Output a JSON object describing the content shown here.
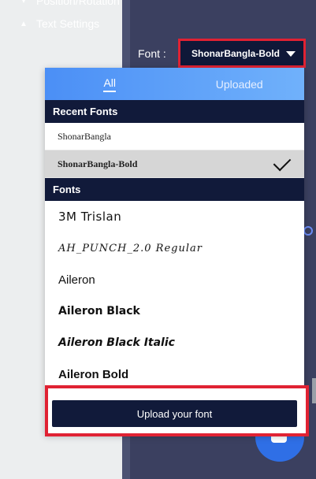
{
  "panel": {
    "position_rotation": "Position/Rotation",
    "text_settings": "Text Settings",
    "font_label": "Font :",
    "font_selected": "ShonarBangla-Bold"
  },
  "dropdown": {
    "tabs": [
      {
        "label": "All",
        "active": true
      },
      {
        "label": "Uploaded",
        "active": false
      }
    ],
    "recent_header": "Recent Fonts",
    "recent": [
      {
        "label": "ShonarBangla",
        "selected": false
      },
      {
        "label": "ShonarBangla-Bold",
        "selected": true
      }
    ],
    "fonts_header": "Fonts",
    "fonts": [
      {
        "label": "3M Trislan"
      },
      {
        "label": "AH_PUNCH_2.0 Regular"
      },
      {
        "label": "Aileron"
      },
      {
        "label": "Aileron Black"
      },
      {
        "label": "Aileron Black Italic"
      },
      {
        "label": "Aileron Bold"
      }
    ],
    "upload_label": "Upload your font"
  },
  "colors": {
    "panel_bg": "#3b4060",
    "header_dark": "#111a3a",
    "tab_gradient_start": "#4b8ff6",
    "highlight_red": "#e02233",
    "fab_blue": "#2f6fe6"
  }
}
